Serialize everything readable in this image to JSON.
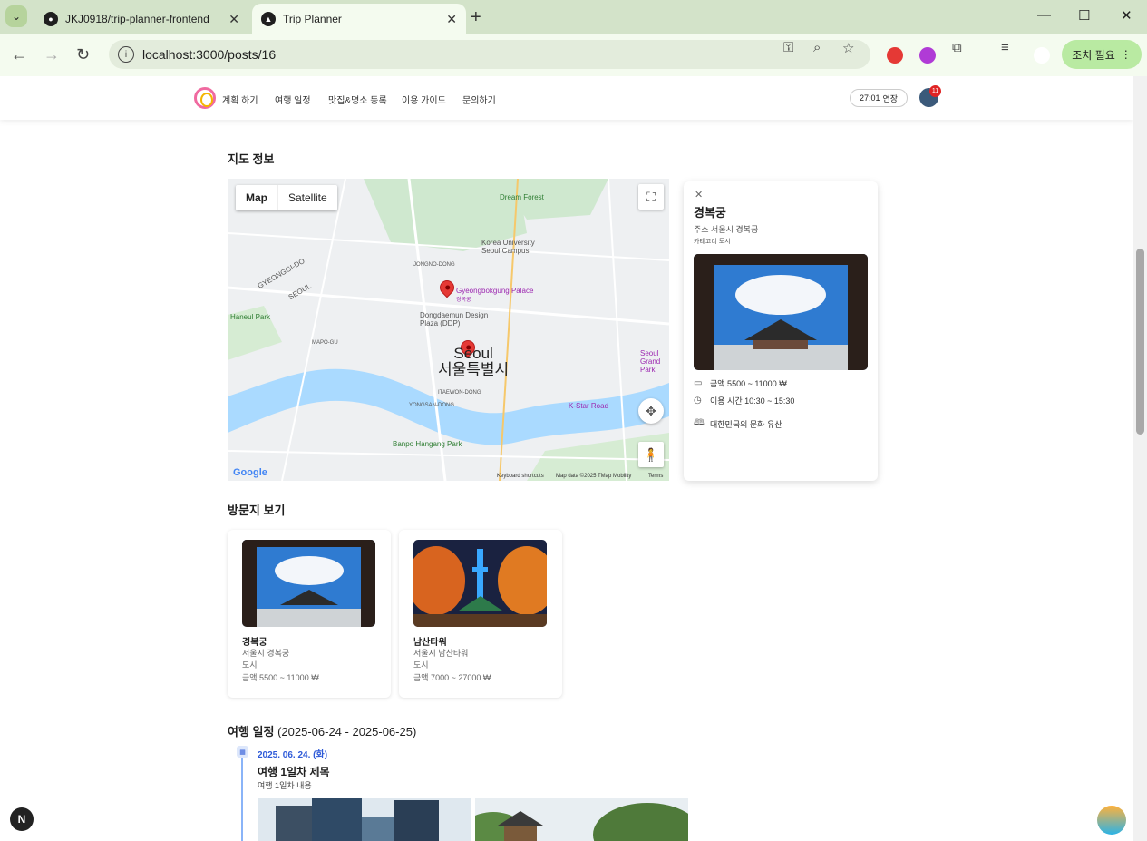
{
  "browser": {
    "tabs": [
      {
        "title": "JKJ0918/trip-planner-frontend",
        "active": false
      },
      {
        "title": "Trip Planner",
        "active": true
      }
    ],
    "url": "localhost:3000/posts/16",
    "action_label": "조치 필요"
  },
  "app_nav": {
    "links": [
      "계획 하기",
      "여행 일정",
      "맛집&명소 등록",
      "이용 가이드",
      "문의하기"
    ],
    "timer": "27:01",
    "timer_action": "연장",
    "notification_count": "11"
  },
  "map_section": {
    "title": "지도 정보",
    "map_type": {
      "map": "Map",
      "satellite": "Satellite"
    },
    "labels": {
      "palace_en": "Gyeongbokgung Palace",
      "palace_ko": "경복궁",
      "city_en": "Seoul",
      "city_ko": "서울특별시",
      "ddp": "Dongdaemun Design Plaza (DDP)",
      "dream_forest": "Dream Forest",
      "korea_univ": "Korea University Seoul Campus",
      "haneul_park": "Haneul Park",
      "banpo": "Banpo Hangang Park",
      "kstar": "K-Star Road",
      "seoul_grand": "Seoul Grand Park",
      "gyeonggi": "GYEONGGI-DO",
      "seoul_en": "SEOUL",
      "itaewon": "ITAEWON-DONG",
      "yongsan": "YONGSAN-DONG",
      "jongno": "JONGNO-DONG",
      "mapo": "MAPO-GU"
    },
    "footer": {
      "shortcuts": "Keyboard shortcuts",
      "data": "Map data ©2025 TMap Mobility",
      "terms": "Terms",
      "google": "Google"
    }
  },
  "info_card": {
    "name": "경복궁",
    "address": "주소 서울시 경복궁",
    "category": "카테고리 도시",
    "price": "금액 5500 ~ 11000 ₩",
    "hours": "이용 시간 10:30 ~ 15:30",
    "description": "대한민국의 문화 유산"
  },
  "visits": {
    "title": "방문지 보기",
    "items": [
      {
        "name": "경복궁",
        "address": "서울시 경복궁",
        "category": "도시",
        "price": "금액 5500 ~ 11000 ₩"
      },
      {
        "name": "남산타워",
        "address": "서울시 남산타워",
        "category": "도시",
        "price": "금액 7000 ~ 27000 ₩"
      }
    ]
  },
  "schedule": {
    "title": "여행 일정",
    "range": "(2025-06-24 - 2025-06-25)",
    "days": [
      {
        "date": "2025. 06. 24. (화)",
        "title": "여행 1일차 제목",
        "content": "여행 1일차 내용"
      }
    ]
  },
  "floating": {
    "next_badge": "N"
  }
}
